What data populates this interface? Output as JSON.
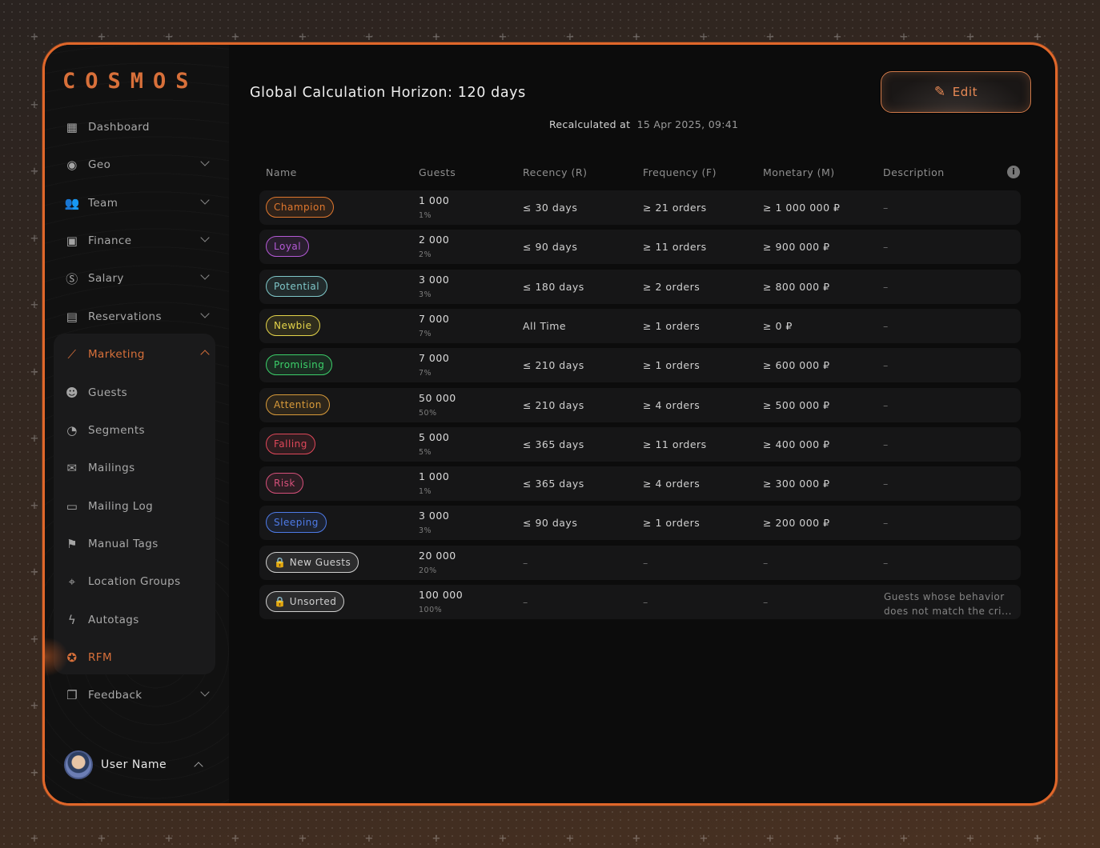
{
  "app": {
    "logo": "COSMOS"
  },
  "sidebar": {
    "items": [
      {
        "label": "Dashboard",
        "icon": "dashboard-icon"
      },
      {
        "label": "Geo",
        "icon": "globe-icon"
      },
      {
        "label": "Team",
        "icon": "team-icon"
      },
      {
        "label": "Finance",
        "icon": "finance-icon"
      },
      {
        "label": "Salary",
        "icon": "salary-icon"
      },
      {
        "label": "Reservations",
        "icon": "calendar-icon"
      },
      {
        "label": "Marketing",
        "icon": "marketing-icon"
      },
      {
        "label": "Guests",
        "icon": "guests-icon"
      },
      {
        "label": "Segments",
        "icon": "pie-icon"
      },
      {
        "label": "Mailings",
        "icon": "mail-icon"
      },
      {
        "label": "Mailing Log",
        "icon": "chat-icon"
      },
      {
        "label": "Manual Tags",
        "icon": "tag-icon"
      },
      {
        "label": "Location Groups",
        "icon": "location-icon"
      },
      {
        "label": "Autotags",
        "icon": "bolt-icon"
      },
      {
        "label": "RFM",
        "icon": "rfm-icon"
      },
      {
        "label": "Feedback",
        "icon": "feedback-icon"
      }
    ],
    "user": {
      "name": "User Name"
    }
  },
  "header": {
    "title": "Global Calculation Horizon:",
    "title_value": "120 days",
    "recalc_label": "Recalculated at",
    "recalc_value": "15 Apr 2025, 09:41",
    "edit_label": "Edit"
  },
  "table": {
    "columns": [
      "Name",
      "Guests",
      "Recency (R)",
      "Frequency (F)",
      "Monetary (M)",
      "Description"
    ],
    "rows": [
      {
        "name": "Champion",
        "color": "#e0782e",
        "guests": "1 000",
        "pct": "1%",
        "recency": "≤ 30 days",
        "frequency": "≥ 21 orders",
        "monetary": "≥ 1 000 000 ₽",
        "description": "–"
      },
      {
        "name": "Loyal",
        "color": "#b45ad6",
        "guests": "2 000",
        "pct": "2%",
        "recency": "≤ 90 days",
        "frequency": "≥ 11 orders",
        "monetary": "≥ 900 000 ₽",
        "description": "–"
      },
      {
        "name": "Potential",
        "color": "#7fc7c9",
        "guests": "3 000",
        "pct": "3%",
        "recency": "≤ 180 days",
        "frequency": "≥ 2 orders",
        "monetary": "≥ 800 000 ₽",
        "description": "–"
      },
      {
        "name": "Newbie",
        "color": "#e4d44a",
        "guests": "7 000",
        "pct": "7%",
        "recency": "All Time",
        "frequency": "≥ 1 orders",
        "monetary": "≥ 0 ₽",
        "description": "–"
      },
      {
        "name": "Promising",
        "color": "#3ccf6a",
        "guests": "7 000",
        "pct": "7%",
        "recency": "≤ 210 days",
        "frequency": "≥ 1 orders",
        "monetary": "≥ 600 000 ₽",
        "description": "–"
      },
      {
        "name": "Attention",
        "color": "#d99b3a",
        "guests": "50 000",
        "pct": "50%",
        "recency": "≤ 210 days",
        "frequency": "≥ 4 orders",
        "monetary": "≥ 500 000 ₽",
        "description": "–"
      },
      {
        "name": "Falling",
        "color": "#e0485a",
        "guests": "5 000",
        "pct": "5%",
        "recency": "≤ 365 days",
        "frequency": "≥ 11 orders",
        "monetary": "≥ 400 000 ₽",
        "description": "–"
      },
      {
        "name": "Risk",
        "color": "#d6507a",
        "guests": "1 000",
        "pct": "1%",
        "recency": "≤ 365 days",
        "frequency": "≥ 4 orders",
        "monetary": "≥ 300 000 ₽",
        "description": "–"
      },
      {
        "name": "Sleeping",
        "color": "#4e7be8",
        "guests": "3 000",
        "pct": "3%",
        "recency": "≤ 90 days",
        "frequency": "≥ 1 orders",
        "monetary": "≥ 200 000 ₽",
        "description": "–"
      },
      {
        "name": "New Guests",
        "color": "#cfcfcf",
        "locked": true,
        "guests": "20 000",
        "pct": "20%",
        "recency": "–",
        "frequency": "–",
        "monetary": "–",
        "description": "–"
      },
      {
        "name": "Unsorted",
        "color": "#cfcfcf",
        "locked": true,
        "guests": "100 000",
        "pct": "100%",
        "recency": "–",
        "frequency": "–",
        "monetary": "–",
        "description": "Guests whose behavior does not match the cri..."
      }
    ]
  }
}
